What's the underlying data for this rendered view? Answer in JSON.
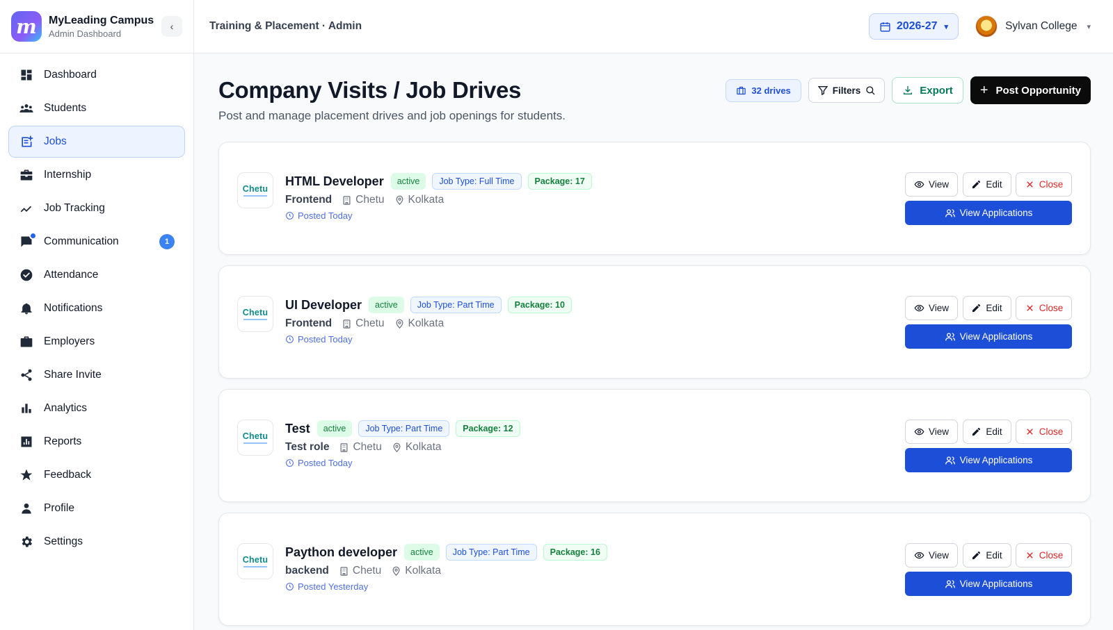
{
  "brand": {
    "logo_letter": "m",
    "name": "MyLeading Campus",
    "subtitle": "Admin Dashboard",
    "collapse_icon": "chevron-left-icon"
  },
  "sidebar": {
    "items": [
      {
        "label": "Dashboard",
        "icon": "dashboard-icon"
      },
      {
        "label": "Students",
        "icon": "students-icon"
      },
      {
        "label": "Jobs",
        "icon": "jobs-icon",
        "active": true
      },
      {
        "label": "Internship",
        "icon": "briefcase-icon"
      },
      {
        "label": "Job Tracking",
        "icon": "trend-icon"
      },
      {
        "label": "Communication",
        "icon": "chat-icon",
        "badge": "1"
      },
      {
        "label": "Attendance",
        "icon": "check-circle-icon"
      },
      {
        "label": "Notifications",
        "icon": "bell-icon"
      },
      {
        "label": "Employers",
        "icon": "suitcase-icon"
      },
      {
        "label": "Share Invite",
        "icon": "share-icon"
      },
      {
        "label": "Analytics",
        "icon": "bar-chart-icon"
      },
      {
        "label": "Reports",
        "icon": "report-icon"
      },
      {
        "label": "Feedback",
        "icon": "star-icon"
      },
      {
        "label": "Profile",
        "icon": "person-icon"
      },
      {
        "label": "Settings",
        "icon": "gear-icon"
      }
    ]
  },
  "topbar": {
    "breadcrumb": "Training & Placement · Admin",
    "year": "2026-27",
    "college": "Sylvan College"
  },
  "page": {
    "title": "Company Visits / Job Drives",
    "subtitle": "Post and manage placement drives and job openings for students.",
    "drives_count": "32 drives",
    "filters_label": "Filters",
    "export_label": "Export",
    "post_label": "Post Opportunity"
  },
  "actions": {
    "view": "View",
    "edit": "Edit",
    "close": "Close",
    "view_applications": "View Applications"
  },
  "jobs": [
    {
      "logo_text": "Chetu",
      "title": "HTML Developer",
      "status": "active",
      "job_type": "Job Type: Full Time",
      "package": "Package: 17",
      "department": "Frontend",
      "company": "Chetu",
      "location": "Kolkata",
      "posted": "Posted Today"
    },
    {
      "logo_text": "Chetu",
      "title": "UI Developer",
      "status": "active",
      "job_type": "Job Type: Part Time",
      "package": "Package: 10",
      "department": "Frontend",
      "company": "Chetu",
      "location": "Kolkata",
      "posted": "Posted Today"
    },
    {
      "logo_text": "Chetu",
      "title": "Test",
      "status": "active",
      "job_type": "Job Type: Part Time",
      "package": "Package: 12",
      "department": "Test role",
      "company": "Chetu",
      "location": "Kolkata",
      "posted": "Posted Today"
    },
    {
      "logo_text": "Chetu",
      "title": "Paython developer",
      "status": "active",
      "job_type": "Job Type: Part Time",
      "package": "Package: 16",
      "department": "backend",
      "company": "Chetu",
      "location": "Kolkata",
      "posted": "Posted Yesterday"
    }
  ],
  "colors": {
    "accent": "#1d4ed8",
    "active_bg": "#eef4ff",
    "success": "#15803d",
    "danger": "#dc2626"
  }
}
